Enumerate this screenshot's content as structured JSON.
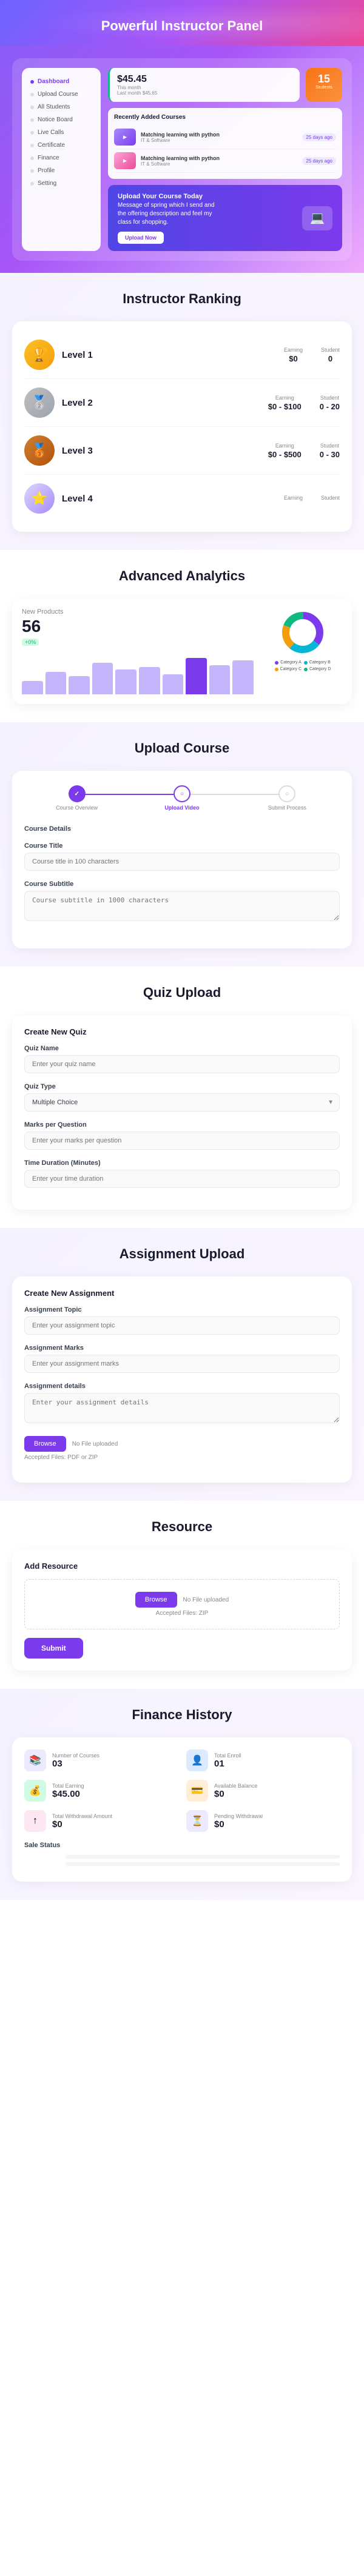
{
  "header": {
    "title": "Powerful Instructor Panel"
  },
  "dashboard": {
    "sidebar": {
      "items": [
        {
          "label": "Dashboard",
          "active": true
        },
        {
          "label": "Upload Course",
          "active": false
        },
        {
          "label": "All Students",
          "active": false
        },
        {
          "label": "Notice Board",
          "active": false
        },
        {
          "label": "Live Calls",
          "active": false
        },
        {
          "label": "Certificate",
          "active": false
        },
        {
          "label": "Finance",
          "active": false
        },
        {
          "label": "Profile",
          "active": false
        },
        {
          "label": "Setting",
          "active": false
        }
      ]
    },
    "balance": {
      "amount": "$45.45",
      "this_month_label": "This month",
      "last_month_label": "Last month",
      "last_month_value": "$45.65"
    },
    "students": {
      "count": "15",
      "label": "Students"
    },
    "recent_courses": {
      "title": "Recently Added Courses",
      "items": [
        {
          "name": "Matching learning with python",
          "meta": "IT & Software",
          "days": "25 days ago"
        },
        {
          "name": "Matching learning with python",
          "meta": "IT & Software",
          "days": "25 days ago"
        }
      ]
    },
    "upload_banner": {
      "title": "Upload Your Course Today",
      "body": "Message of spring which I send and the offering description and feel my class for shopping.",
      "button": "Upload Now"
    }
  },
  "instructor_ranking": {
    "title": "Instructor Ranking",
    "ranks": [
      {
        "label": "Level 1",
        "earning_label": "Earning",
        "earning_value": "$0",
        "student_label": "Student",
        "student_value": "0"
      },
      {
        "label": "Level 2",
        "earning_label": "Earning",
        "earning_value": "$0 - $100",
        "student_label": "Student",
        "student_value": "0 - 20"
      },
      {
        "label": "Level 3",
        "earning_label": "Earning",
        "earning_value": "$0 - $500",
        "student_label": "Student",
        "student_value": "0 - 30"
      },
      {
        "label": "Level 4",
        "earning_label": "Earning",
        "earning_value": "",
        "student_label": "Student",
        "student_value": ""
      }
    ]
  },
  "advanced_analytics": {
    "title": "Advanced Analytics",
    "new_products": {
      "label": "New Products",
      "value": "56",
      "sub": "+0%"
    },
    "bars": [
      30,
      50,
      40,
      70,
      55,
      60,
      45,
      80,
      65,
      75
    ],
    "active_bar": 7,
    "donut": {
      "segments": [
        {
          "label": "Category A",
          "color": "#7c3aed",
          "value": 35
        },
        {
          "label": "Category B",
          "color": "#06b6d4",
          "value": 25
        },
        {
          "label": "Category C",
          "color": "#f59e0b",
          "value": 20
        },
        {
          "label": "Category D",
          "color": "#10b981",
          "value": 20
        }
      ]
    }
  },
  "upload_course": {
    "title": "Upload Course",
    "steps": [
      {
        "label": "Course Overview",
        "state": "completed"
      },
      {
        "label": "Upload Video",
        "state": "active"
      },
      {
        "label": "Submit Process",
        "state": "inactive"
      }
    ],
    "form": {
      "course_details_label": "Course Details",
      "course_title_label": "Course Title",
      "course_title_placeholder": "Course title in 100 characters",
      "course_subtitle_label": "Course Subtitle",
      "course_subtitle_placeholder": "Course subtitle in 1000 characters"
    }
  },
  "quiz_upload": {
    "title": "Quiz Upload",
    "create_title": "Create New Quiz",
    "fields": [
      {
        "label": "Quiz Name",
        "placeholder": "Enter your quiz name",
        "type": "input"
      },
      {
        "label": "Quiz Type",
        "placeholder": "Multiple Choice",
        "type": "select"
      },
      {
        "label": "Marks per Question",
        "placeholder": "Enter your marks per question",
        "type": "input"
      },
      {
        "label": "Time Duration (Minutes)",
        "placeholder": "Enter your time duration",
        "type": "input"
      }
    ]
  },
  "assignment_upload": {
    "title": "Assignment Upload",
    "create_title": "Create New Assignment",
    "fields": [
      {
        "label": "Assignment Topic",
        "placeholder": "Enter your assignment topic",
        "type": "input"
      },
      {
        "label": "Assignment Marks",
        "placeholder": "Enter your assignment marks",
        "type": "input"
      },
      {
        "label": "Assignment details",
        "placeholder": "Enter your assignment details",
        "type": "textarea"
      }
    ],
    "browse_label": "Browse",
    "file_status": "No File uploaded",
    "accepted": "Accepted Files: PDF or ZIP"
  },
  "resource": {
    "title": "Resource",
    "add_title": "Add Resource",
    "browse_label": "Browse",
    "file_status": "No File uploaded",
    "accepted": "Accepted Files: ZIP",
    "submit_label": "Submit"
  },
  "finance": {
    "title": "Finance History",
    "items": [
      {
        "label": "Number of Courses",
        "value": "03",
        "icon": "📚",
        "icon_class": "finance-icon-purple"
      },
      {
        "label": "Total Enroll",
        "value": "01",
        "icon": "👤",
        "icon_class": "finance-icon-blue"
      },
      {
        "label": "Total Earning",
        "value": "$45.00",
        "icon": "💰",
        "icon_class": "finance-icon-green"
      },
      {
        "label": "Available Balance",
        "value": "$0",
        "icon": "💳",
        "icon_class": "finance-icon-orange"
      },
      {
        "label": "Total Withdrawal Amount",
        "value": "$0",
        "icon": "↑",
        "icon_class": "finance-icon-pink"
      },
      {
        "label": "Pending Withdrawal",
        "value": "$0",
        "icon": "⏳",
        "icon_class": "finance-icon-purple"
      }
    ],
    "sale_status": {
      "title": "Sale Status",
      "bars": [
        {
          "label": "",
          "value": 0,
          "color": "#7c3aed"
        },
        {
          "label": "",
          "value": 0,
          "color": "#10b981"
        }
      ]
    }
  },
  "icons": {
    "dashboard": "⊞",
    "upload": "↑",
    "students": "👥",
    "notice": "📋",
    "live": "📹",
    "cert": "🏆",
    "finance": "💰",
    "profile": "👤",
    "settings": "⚙"
  }
}
